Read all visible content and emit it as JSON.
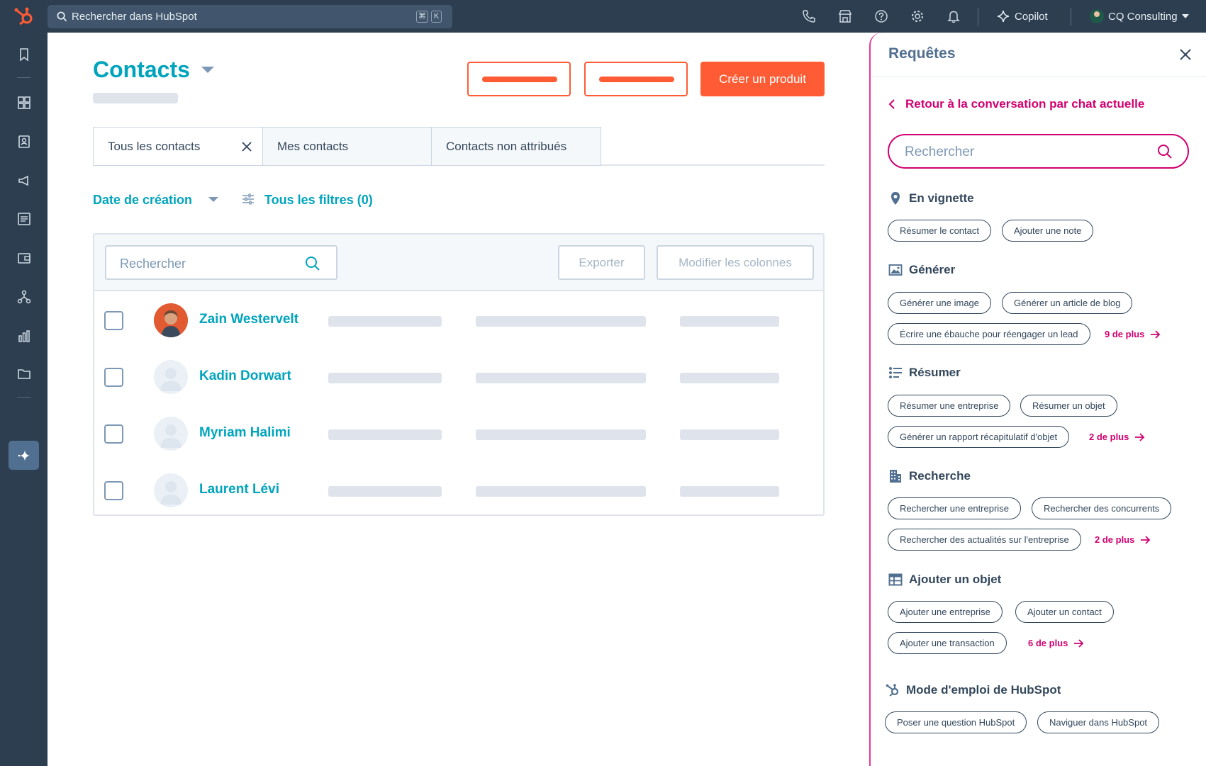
{
  "topbar": {
    "search_placeholder": "Rechercher dans HubSpot",
    "shortcut_cmd": "⌘",
    "shortcut_key": "K",
    "copilot_label": "Copilot",
    "account_name": "CQ Consulting"
  },
  "main": {
    "title": "Contacts",
    "primary_button": "Créer un produit",
    "tabs": [
      {
        "label": "Tous les contacts"
      },
      {
        "label": "Mes contacts"
      },
      {
        "label": "Contacts non attribués"
      }
    ],
    "filter_date": "Date de création",
    "filter_all": "Tous les filtres (0)",
    "table": {
      "search_placeholder": "Rechercher",
      "export_label": "Exporter",
      "columns_label": "Modifier les colonnes",
      "rows": [
        {
          "name": "Zain Westervelt"
        },
        {
          "name": "Kadin Dorwart"
        },
        {
          "name": "Myriam Halimi"
        },
        {
          "name": "Laurent Lévi"
        }
      ]
    }
  },
  "panel": {
    "title": "Requêtes",
    "back_label": "Retour à la conversation par chat actuelle",
    "search_placeholder": "Rechercher",
    "sections": [
      {
        "title": "En vignette",
        "chips": [
          "Résumer le contact",
          "Ajouter une note"
        ]
      },
      {
        "title": "Générer",
        "chips": [
          "Générer une image",
          "Générer un article de blog",
          "Écrire une ébauche pour réengager un lead"
        ],
        "more": "9 de plus"
      },
      {
        "title": "Résumer",
        "chips": [
          "Résumer une entreprise",
          "Résumer un objet",
          "Générer un rapport récapitulatif d'objet"
        ],
        "more": "2 de plus"
      },
      {
        "title": "Recherche",
        "chips": [
          "Rechercher une entreprise",
          "Rechercher des concurrents",
          "Rechercher des actualités sur l'entreprise"
        ],
        "more": "2 de plus"
      },
      {
        "title": "Ajouter un objet",
        "chips": [
          "Ajouter une entreprise",
          "Ajouter un contact",
          "Ajouter une transaction"
        ],
        "more": "6 de plus"
      },
      {
        "title": "Mode d'emploi de HubSpot",
        "chips": [
          "Poser une question HubSpot",
          "Naviguer dans HubSpot"
        ]
      }
    ]
  },
  "colors": {
    "nav_bg": "#2d3e50",
    "accent_teal": "#00a4bd",
    "accent_orange": "#ff5c35",
    "accent_magenta": "#d10070"
  }
}
